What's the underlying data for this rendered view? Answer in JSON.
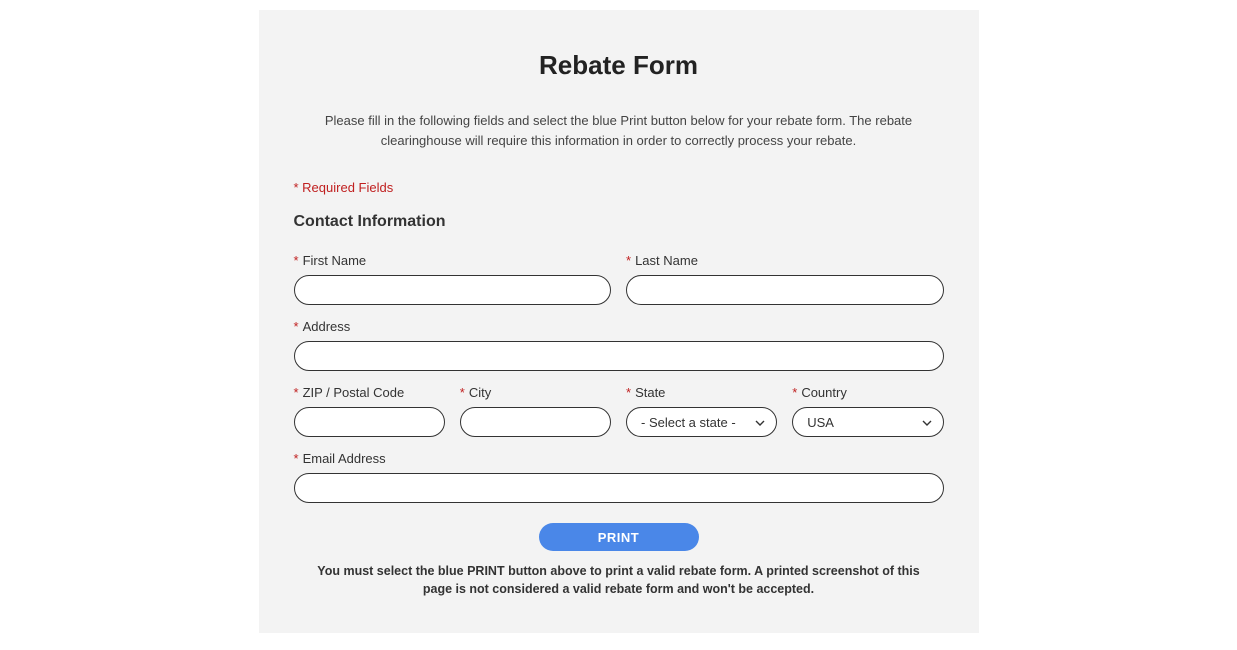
{
  "title": "Rebate Form",
  "instructions": "Please fill in the following fields and select the blue Print button below for your rebate form. The rebate clearinghouse will require this information in order to correctly process your rebate.",
  "required_note": "* Required Fields",
  "section_heading": "Contact Information",
  "fields": {
    "first_name": {
      "label": "First Name",
      "value": ""
    },
    "last_name": {
      "label": "Last Name",
      "value": ""
    },
    "address": {
      "label": "Address",
      "value": ""
    },
    "zip": {
      "label": "ZIP / Postal Code",
      "value": ""
    },
    "city": {
      "label": "City",
      "value": ""
    },
    "state": {
      "label": "State",
      "placeholder": "- Select a state -",
      "value": ""
    },
    "country": {
      "label": "Country",
      "value": "USA"
    },
    "email": {
      "label": "Email Address",
      "value": ""
    }
  },
  "print_button": "PRINT",
  "footer_note": "You must select the blue PRINT button above to print a valid rebate form. A printed screenshot of this page is not considered a valid rebate form and won't be accepted."
}
